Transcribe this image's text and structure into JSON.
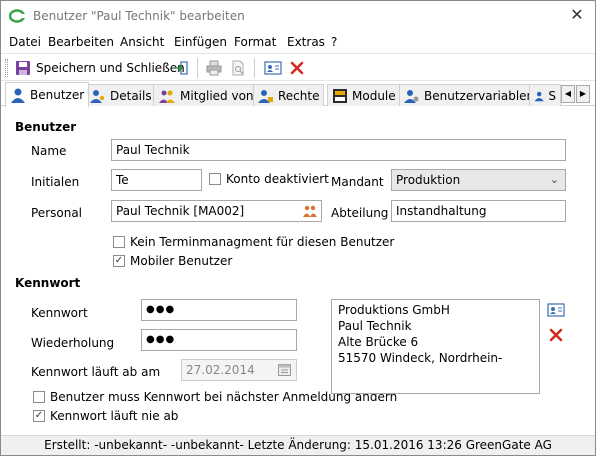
{
  "window": {
    "title": "Benutzer \"Paul Technik\" bearbeiten"
  },
  "menu": [
    "Datei",
    "Bearbeiten",
    "Ansicht",
    "Einfügen",
    "Format",
    "Extras",
    "?"
  ],
  "toolbar": {
    "save_close": "Speichern und Schließen"
  },
  "tabs": [
    "Benutzer",
    "Details",
    "Mitglied von",
    "Rechte",
    "Module",
    "Benutzervariablen",
    "S"
  ],
  "benutzer": {
    "heading": "Benutzer",
    "name_label": "Name",
    "name_value": "Paul Technik",
    "initialen_label": "Initialen",
    "initialen_value": "Te",
    "konto_deaktiviert": "Konto deaktiviert",
    "mandant_label": "Mandant",
    "mandant_value": "Produktion",
    "personal_label": "Personal",
    "personal_value": "Paul Technik [MA002]",
    "abteilung_label": "Abteilung",
    "abteilung_value": "Instandhaltung",
    "kein_termin": "Kein Terminmanagment für diesen Benutzer",
    "mobiler_benutzer": "Mobiler Benutzer"
  },
  "kennwort": {
    "heading": "Kennwort",
    "kennwort_label": "Kennwort",
    "kennwort_value": "●●●",
    "wiederholung_label": "Wiederholung",
    "wiederholung_value": "●●●",
    "ablauf_label": "Kennwort läuft ab am",
    "ablauf_value": "27.02.2014",
    "aendern": "Benutzer muss Kennwort bei nächster Anmeldung ändern",
    "nie_ab": "Kennwort läuft nie ab"
  },
  "address": {
    "line1": "Produktions GmbH",
    "line2": "Paul Technik",
    "line3": "Alte Brücke 6",
    "line4": "51570 Windeck, Nordrhein-"
  },
  "checks": {
    "konto_deaktiviert": false,
    "kein_termin": false,
    "mobiler_benutzer": true,
    "aendern": false,
    "nie_ab": true
  },
  "status": {
    "text": "Erstellt: -unbekannt- -unbekannt-  Letzte Änderung: 15.01.2016 13:26 GreenGate AG"
  },
  "colors": {
    "accent_green": "#3aa645",
    "save_purple": "#7a3fa0",
    "delete_red": "#d22b1f"
  }
}
